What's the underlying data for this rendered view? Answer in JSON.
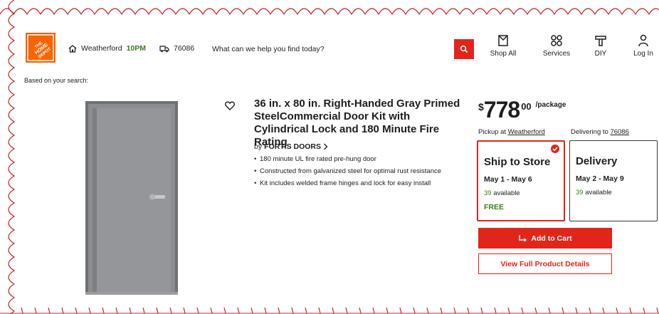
{
  "header": {
    "logo_text": "THE HOME DEPOT",
    "store_name": "Weatherford",
    "store_hours": "10PM",
    "zip": "76086",
    "search_placeholder": "What can we help you find today?",
    "nav": [
      {
        "label": "Shop All",
        "icon": "catalog-icon"
      },
      {
        "label": "Services",
        "icon": "services-icon"
      },
      {
        "label": "DIY",
        "icon": "diy-icon"
      },
      {
        "label": "Log In",
        "icon": "user-icon"
      }
    ]
  },
  "based_on_search": "Based on your search:",
  "product": {
    "title": "36 in. x 80 in. Right-Handed Gray Primed SteelCommercial Door Kit with Cylindrical Lock and 180 Minute Fire Rating",
    "by_prefix": "by",
    "brand": "FORTIS DOORS",
    "bullets": [
      "180 minute UL fire rated pre-hung door",
      "Constructed from galvanized steel for optimal rust resistance",
      "Kit includes welded frame hinges and lock for easy install"
    ]
  },
  "buybox": {
    "currency": "$",
    "price_dollars": "778",
    "price_cents": "00",
    "price_unit": "/package",
    "pickup_prefix": "Pickup at",
    "pickup_store": "Weatherford",
    "delivery_prefix": "Delivering to",
    "delivery_zip": "76086",
    "ship_card": {
      "title": "Ship to Store",
      "dates": "May 1 - May 6",
      "count": "39",
      "avail": "available",
      "free": "FREE"
    },
    "delivery_card": {
      "title": "Delivery",
      "dates": "May 2 - May 9",
      "count": "39",
      "avail": "available"
    },
    "add_to_cart": "Add to Cart",
    "view_details": "View Full Product Details"
  },
  "colors": {
    "brand_orange": "#f96302",
    "action_red": "#e2251b",
    "available_green": "#3e7b1e"
  }
}
